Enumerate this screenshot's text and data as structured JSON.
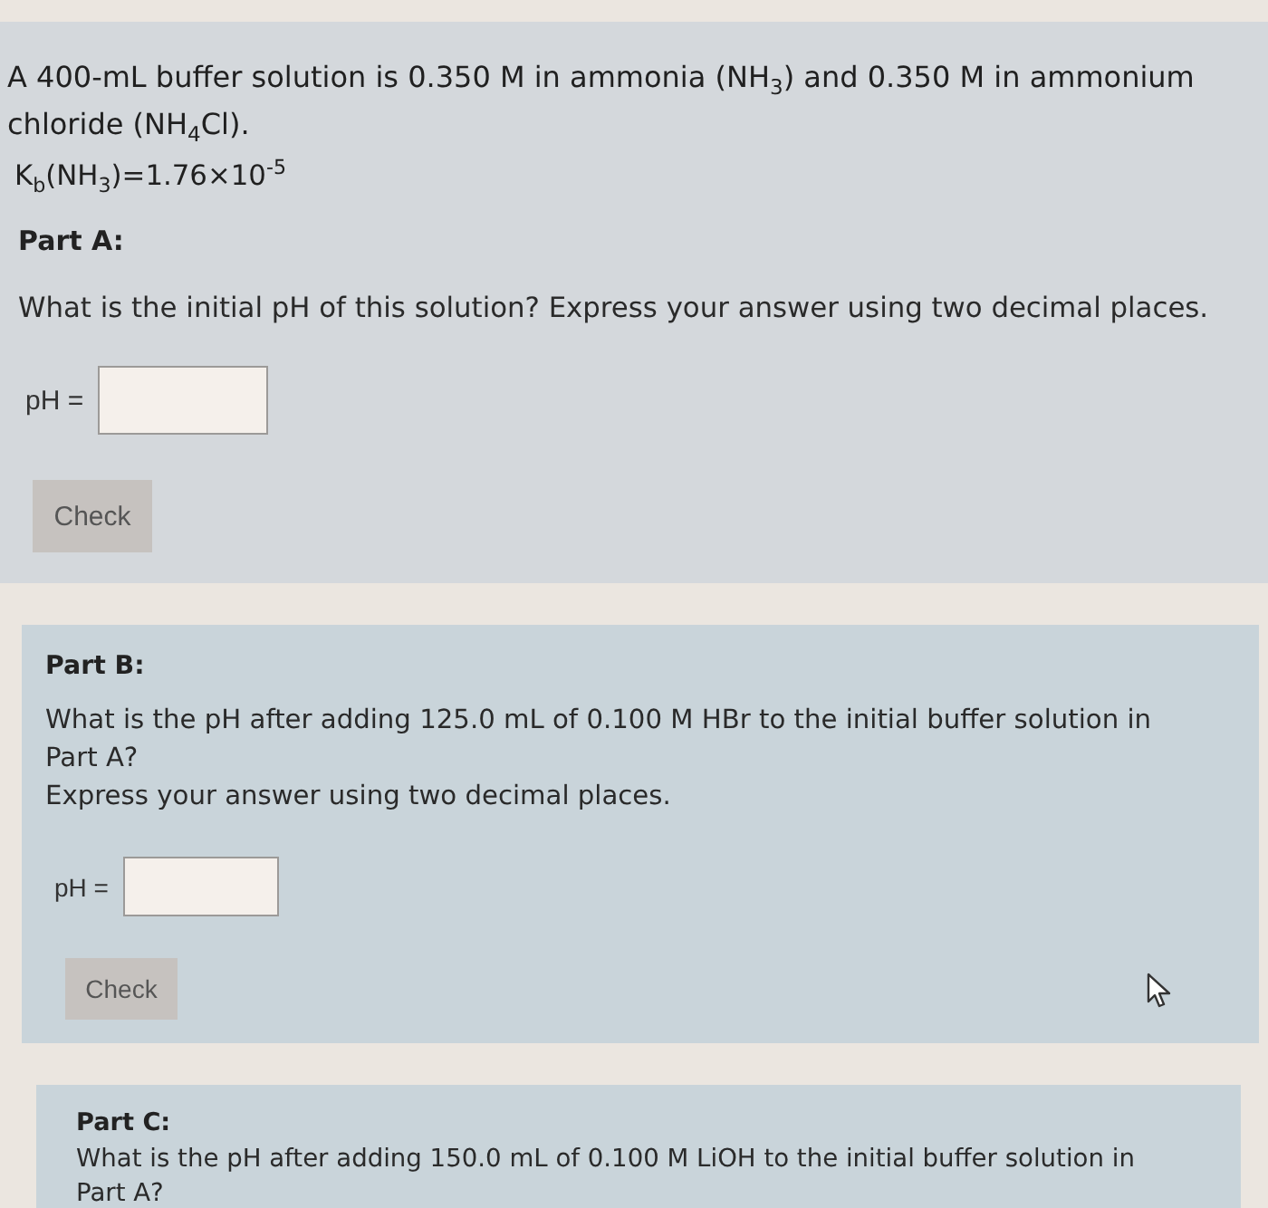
{
  "problem": {
    "statement": "A 400-mL buffer solution is 0.350 M in ammonia (NH$_{3}$) and 0.350 M in ammonium chloride (NH$_{4}$Cl).",
    "constant": "K$_{b}$(NH$_{3}$)=1.76×10$^{-5}$"
  },
  "parts": [
    {
      "kind": "inline",
      "label": "Part A:",
      "prompt": [
        "What is the initial pH of this solution? Express your answer using two decimal places."
      ],
      "answer": {
        "label": "pH ="
      },
      "button": "Check"
    },
    {
      "kind": "card",
      "label": "Part B:",
      "prompt": [
        "What is the pH after adding 125.0 mL of 0.100 M HBr to the initial buffer solution in Part A?",
        "Express your answer using two decimal places."
      ],
      "answer": {
        "label": "pH ="
      },
      "button": "Check"
    },
    {
      "kind": "card",
      "label": "Part C:",
      "prompt": [
        "What is the pH after adding 150.0 mL of 0.100 M LiOH to the initial buffer solution in Part A?"
      ]
    }
  ]
}
